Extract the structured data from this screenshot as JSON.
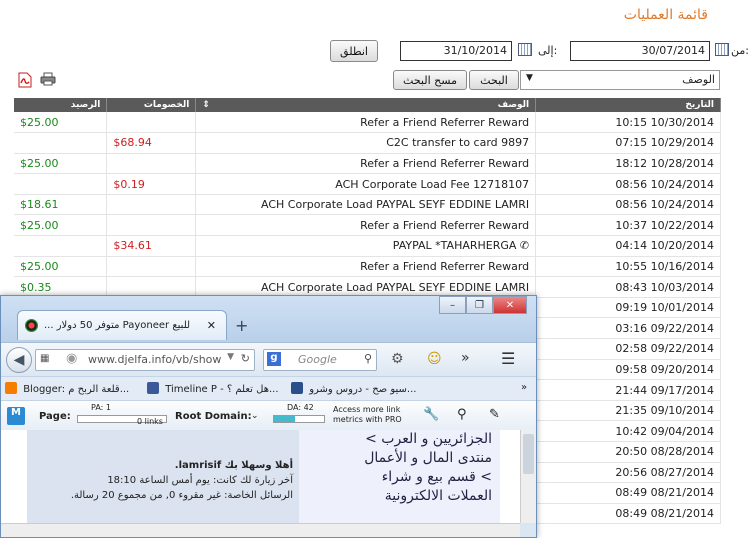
{
  "page": {
    "title": "قائمة العمليات"
  },
  "filters": {
    "from_label": "من:",
    "from_value": "30/07/2014",
    "to_label": "إلى:",
    "to_value": "31/10/2014",
    "go_label": "انطلق",
    "field_select": "الوصف",
    "search_value": "",
    "search_label": "البحث",
    "clear_label": "مسح البحث"
  },
  "table": {
    "headers": {
      "date": "التاريخ",
      "description": "الوصف",
      "deductions": "الخصومات",
      "balance": "الرصيد"
    },
    "rows": [
      {
        "date": "10:15 10/30/2014",
        "description": "Refer a Friend Referrer Reward",
        "deduction": "",
        "balance": "$25.00"
      },
      {
        "date": "07:15 10/29/2014",
        "description": "C2C transfer to card 9897",
        "deduction": "$68.94",
        "balance": ""
      },
      {
        "date": "18:12 10/28/2014",
        "description": "Refer a Friend Referrer Reward",
        "deduction": "",
        "balance": "$25.00"
      },
      {
        "date": "08:56 10/24/2014",
        "description": "ACH Corporate Load Fee 12718107",
        "deduction": "$0.19",
        "balance": ""
      },
      {
        "date": "08:56 10/24/2014",
        "description": "ACH Corporate Load PAYPAL SEYF EDDINE LAMRI",
        "deduction": "",
        "balance": "$18.61"
      },
      {
        "date": "10:37 10/22/2014",
        "description": "Refer a Friend Referrer Reward",
        "deduction": "",
        "balance": "$25.00"
      },
      {
        "date": "04:14 10/20/2014",
        "description": "PAYPAL *TAHARHERGA",
        "deduction": "$34.61",
        "balance": ""
      },
      {
        "date": "10:55 10/16/2014",
        "description": "Refer a Friend Referrer Reward",
        "deduction": "",
        "balance": "$25.00"
      },
      {
        "date": "08:43 10/03/2014",
        "description": "ACH Corporate Load PAYPAL SEYF EDDINE LAMRI",
        "deduction": "",
        "balance": "$0.35"
      },
      {
        "date": "09:19 10/01/2014",
        "description": "",
        "deduction": "",
        "balance": ""
      },
      {
        "date": "03:16 09/22/2014",
        "description": "",
        "deduction": "",
        "balance": ""
      },
      {
        "date": "02:58 09/22/2014",
        "description": "",
        "deduction": "",
        "balance": ""
      },
      {
        "date": "09:58 09/20/2014",
        "description": "",
        "deduction": "",
        "balance": ""
      },
      {
        "date": "21:44 09/17/2014",
        "description": "",
        "deduction": "",
        "balance": ""
      },
      {
        "date": "21:35 09/10/2014",
        "description": "",
        "deduction": "",
        "balance": ""
      },
      {
        "date": "10:42 09/04/2014",
        "description": "",
        "deduction": "",
        "balance": ""
      },
      {
        "date": "20:50 08/28/2014",
        "description": "",
        "deduction": "",
        "balance": ""
      },
      {
        "date": "20:56 08/27/2014",
        "description": "",
        "deduction": "",
        "balance": ""
      },
      {
        "date": "08:49 08/21/2014",
        "description": "",
        "deduction": "",
        "balance": ""
      },
      {
        "date": "08:49 08/21/2014",
        "description": "",
        "deduction": "",
        "balance": ""
      }
    ]
  },
  "browser": {
    "tab_title": "للبيع Payoneer متوفر 50 دولار ...",
    "url": "www.djelfa.info/vb/show",
    "search_engine": "Google",
    "bookmarks": [
      {
        "label": "Blogger: قلعة الربح م..."
      },
      {
        "label": "Timeline P - هل تعلم ؟..."
      },
      {
        "label": "سيو صح - دروس وشرو..."
      }
    ],
    "moz": {
      "page_label": "Page:",
      "pa": "PA: 1",
      "links": "0 links",
      "root_label": "Root Domain:",
      "da": "DA: 42",
      "pro_text": "Access more link metrics with PRO"
    },
    "content": {
      "breadcrumb_1": "الجزائريين و العرب >",
      "breadcrumb_2": "منتدى المال و الأعمال",
      "breadcrumb_3": "> قسم بيع و شراء",
      "breadcrumb_4": "العملات الالكترونية",
      "welcome": "أهلا وسهلا بك lamrisif.",
      "last_visit": "آخر زيارة لك كانت: يوم أمس الساعة 18:10",
      "messages": "الرسائل الخاصة: غير مقروء 0, من مجموع 20 رسالة."
    }
  }
}
